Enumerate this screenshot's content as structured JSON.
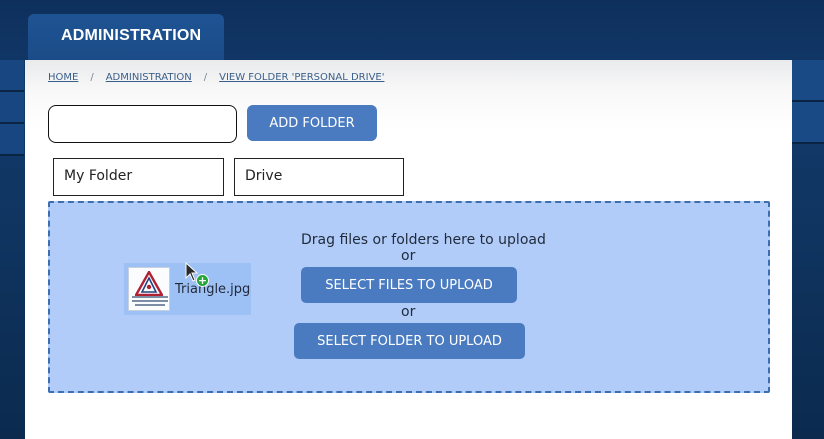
{
  "header": {
    "tab_label": "ADMINISTRATION"
  },
  "breadcrumb": {
    "items": [
      "HOME",
      "ADMINISTRATION",
      "VIEW FOLDER 'PERSONAL DRIVE'"
    ],
    "separator": "/"
  },
  "folder_form": {
    "input_value": "",
    "add_button_label": "ADD FOLDER"
  },
  "path_chips": [
    "My Folder",
    "Drive"
  ],
  "dropzone": {
    "prompt": "Drag files or folders here to upload",
    "or_1": "or",
    "select_files_label": "SELECT FILES TO UPLOAD",
    "or_2": "or",
    "select_folder_label": "SELECT FOLDER TO UPLOAD"
  },
  "drag_ghost": {
    "file_name": "Triangle.jpg",
    "badge": "+",
    "icons": [
      "file-thumbnail-icon",
      "plus-badge-icon",
      "mouse-pointer-icon"
    ]
  },
  "colors": {
    "background": "#123a6b",
    "tab": "#1e5393",
    "button": "#4a7bc0",
    "dropzone": "#b2ccfa",
    "dropzone_border": "#3d6fb0",
    "plus_badge": "#1fa32f"
  }
}
